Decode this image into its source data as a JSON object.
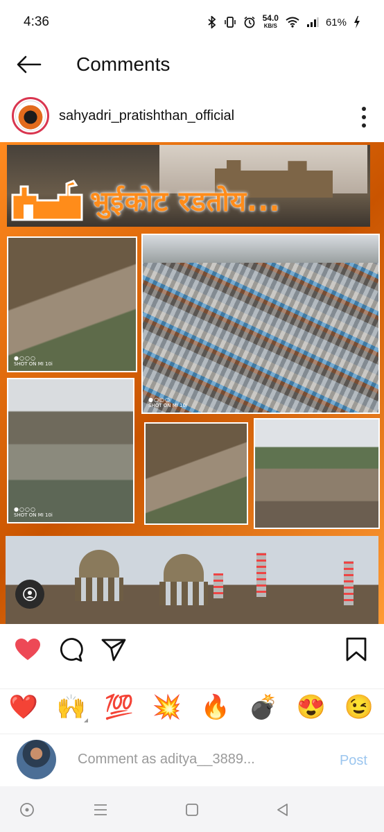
{
  "status_bar": {
    "time": "4:36",
    "net_speed_value": "54.0",
    "net_speed_unit": "KB/S",
    "battery": "61%"
  },
  "header": {
    "title": "Comments",
    "back_icon": "arrow-left-icon"
  },
  "post": {
    "username": "sahyadri_pratishthan_official",
    "image_banner_text": "भुईकोट रडतोय...",
    "shot_labels": [
      "SHOT ON MI 10i",
      "SHOT ON MI 10i",
      "SHOT ON MI 10i"
    ],
    "shot_dots": "●○○○"
  },
  "actions": {
    "liked": true,
    "like_color": "#ed4956",
    "icons": [
      "heart-icon",
      "comment-icon",
      "share-icon",
      "bookmark-icon"
    ]
  },
  "reactions": [
    "❤️",
    "🙌",
    "💯",
    "💥",
    "🔥",
    "💣",
    "😍",
    "😉"
  ],
  "comment_bar": {
    "placeholder": "Comment as aditya__3889...",
    "post_label": "Post",
    "post_color": "#9cc6ef"
  },
  "navbar": {
    "icons": [
      "home-circle-icon",
      "recents-icon",
      "square-icon",
      "back-triangle-icon"
    ]
  },
  "colors": {
    "accent_orange": "#ff8c1a",
    "story_ring": "#d9354f"
  }
}
